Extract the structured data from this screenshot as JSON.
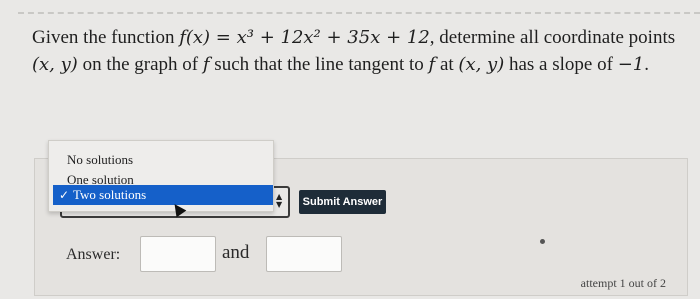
{
  "question": {
    "intro": "Given the function",
    "function_expr": "f(x) = x³ + 12x² + 35x + 12",
    "part2": ", determine all",
    "part3": "coordinate points",
    "point": "(x, y)",
    "part4": "on the graph of",
    "f_symbol": "f",
    "part5": "such that the line tangent to",
    "part6": "at",
    "part7": "has a slope of",
    "slope": "−1",
    "end": "."
  },
  "dropdown": {
    "options": [
      "No solutions",
      "One solution",
      "Two solutions"
    ],
    "selected": "Two solutions",
    "check_icon": "check-icon"
  },
  "submit": {
    "label": "Submit Answer"
  },
  "answer": {
    "label": "Answer:",
    "joiner": "and",
    "value1": "",
    "value2": ""
  },
  "attempt": {
    "text": "attempt 1 out of 2"
  },
  "colors": {
    "selected_bg": "#1560c9",
    "submit_bg": "#1e2c38",
    "page_bg": "#e9e8e6"
  }
}
